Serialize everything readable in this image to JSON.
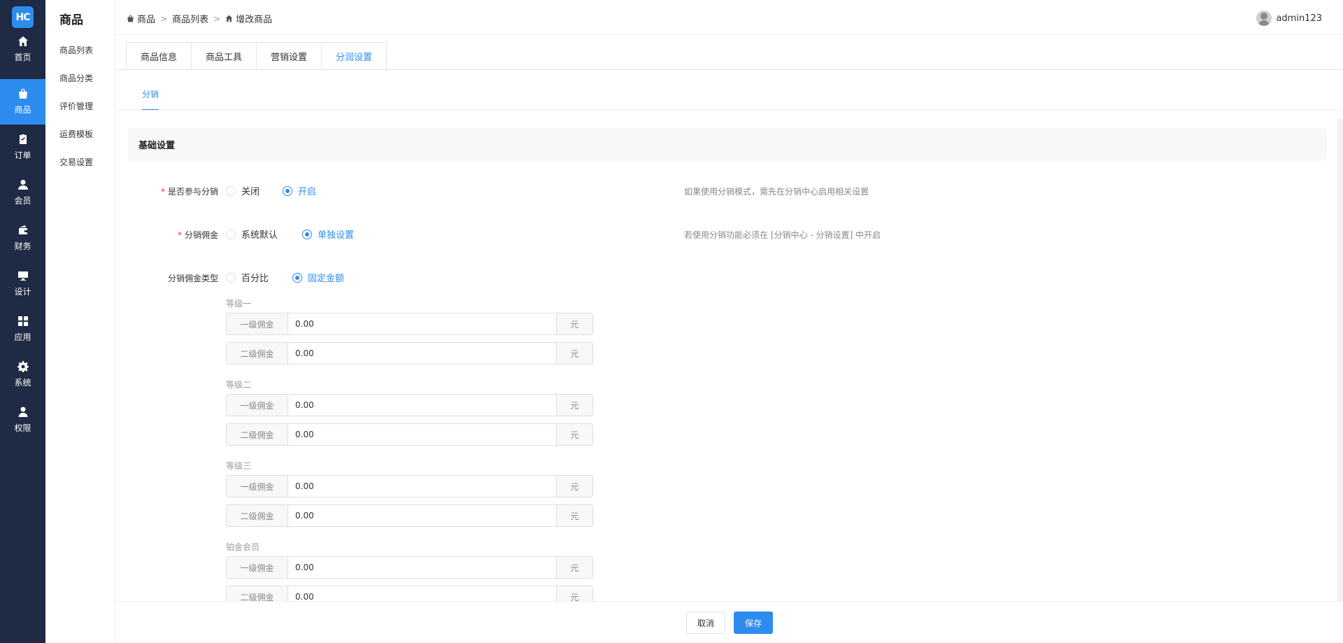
{
  "logo_text": "HC",
  "nav": [
    {
      "label": "首页",
      "icon": "home-icon"
    },
    {
      "label": "商品",
      "icon": "bag-icon",
      "active": true
    },
    {
      "label": "订单",
      "icon": "clipboard-icon"
    },
    {
      "label": "会员",
      "icon": "user-icon"
    },
    {
      "label": "财务",
      "icon": "wallet-icon"
    },
    {
      "label": "设计",
      "icon": "monitor-icon"
    },
    {
      "label": "应用",
      "icon": "grid-icon"
    },
    {
      "label": "系统",
      "icon": "gear-icon"
    },
    {
      "label": "权限",
      "icon": "person-icon"
    }
  ],
  "submenu": {
    "title": "商品",
    "items": [
      "商品列表",
      "商品分类",
      "评价管理",
      "运费模板",
      "交易设置"
    ]
  },
  "breadcrumb": [
    "商品",
    "商品列表",
    "增改商品"
  ],
  "user": {
    "name": "admin123"
  },
  "tabs": [
    "商品信息",
    "商品工具",
    "营销设置",
    "分润设置"
  ],
  "subtab": "分销",
  "section_title": "基础设置",
  "form": {
    "participate": {
      "label": "是否参与分销",
      "options": [
        "关闭",
        "开启"
      ],
      "selected": 1,
      "hint": "如果使用分销模式，需先在分销中心启用相关设置"
    },
    "commission": {
      "label": "分销佣金",
      "options": [
        "系统默认",
        "单独设置"
      ],
      "selected": 1,
      "hint": "若使用分销功能必须在 [分销中心 - 分销设置] 中开启"
    },
    "commission_type": {
      "label": "分销佣金类型",
      "options": [
        "百分比",
        "固定金额"
      ],
      "selected": 1
    }
  },
  "levels": [
    {
      "name": "等级一",
      "first_label": "一级佣金",
      "first_value": "0.00",
      "second_label": "二级佣金",
      "second_value": "0.00",
      "unit": "元"
    },
    {
      "name": "等级二",
      "first_label": "一级佣金",
      "first_value": "0.00",
      "second_label": "二级佣金",
      "second_value": "0.00",
      "unit": "元"
    },
    {
      "name": "等级三",
      "first_label": "一级佣金",
      "first_value": "0.00",
      "second_label": "二级佣金",
      "second_value": "0.00",
      "unit": "元"
    },
    {
      "name": "铂金会员",
      "first_label": "一级佣金",
      "first_value": "0.00",
      "second_label": "二级佣金",
      "second_value": "0.00",
      "unit": "元"
    }
  ],
  "footer": {
    "cancel": "取消",
    "save": "保存"
  },
  "colors": {
    "primary": "#2d8cf0",
    "nav_bg": "#1f2a44",
    "required": "#ed4014"
  }
}
